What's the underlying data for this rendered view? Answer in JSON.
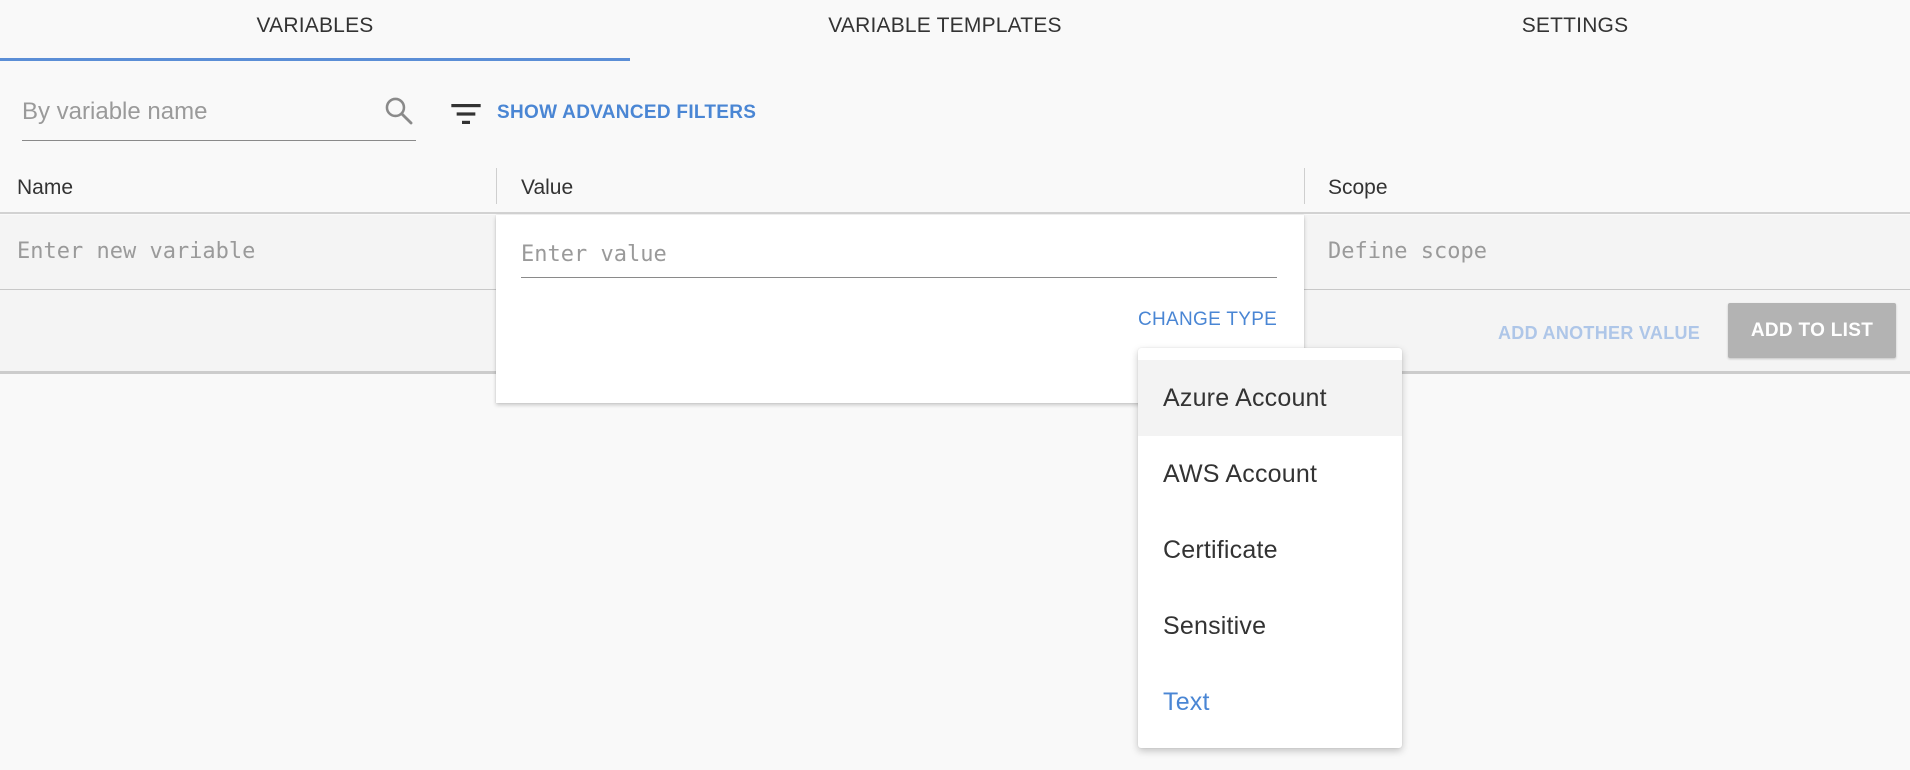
{
  "tabs": [
    {
      "label": "VARIABLES",
      "active": true
    },
    {
      "label": "VARIABLE TEMPLATES",
      "active": false
    },
    {
      "label": "SETTINGS",
      "active": false
    }
  ],
  "filters": {
    "search_placeholder": "By variable name",
    "advanced_filters_label": "SHOW ADVANCED FILTERS"
  },
  "table": {
    "columns": [
      "Name",
      "Value",
      "Scope"
    ]
  },
  "new_variable": {
    "name_placeholder": "Enter new variable",
    "value_placeholder": "Enter value",
    "scope_placeholder": "Define scope",
    "change_type_label": "CHANGE TYPE",
    "add_another_value_label": "ADD ANOTHER VALUE",
    "add_to_list_label": "ADD TO LIST"
  },
  "type_menu": {
    "items": [
      "Azure Account",
      "AWS Account",
      "Certificate",
      "Sensitive",
      "Text"
    ],
    "hovered": "Azure Account",
    "selected": "Text"
  },
  "colors": {
    "accent": "#4a86d4",
    "tab_indicator": "#5b8ed6",
    "disabled_button": "#b3b3b3"
  }
}
